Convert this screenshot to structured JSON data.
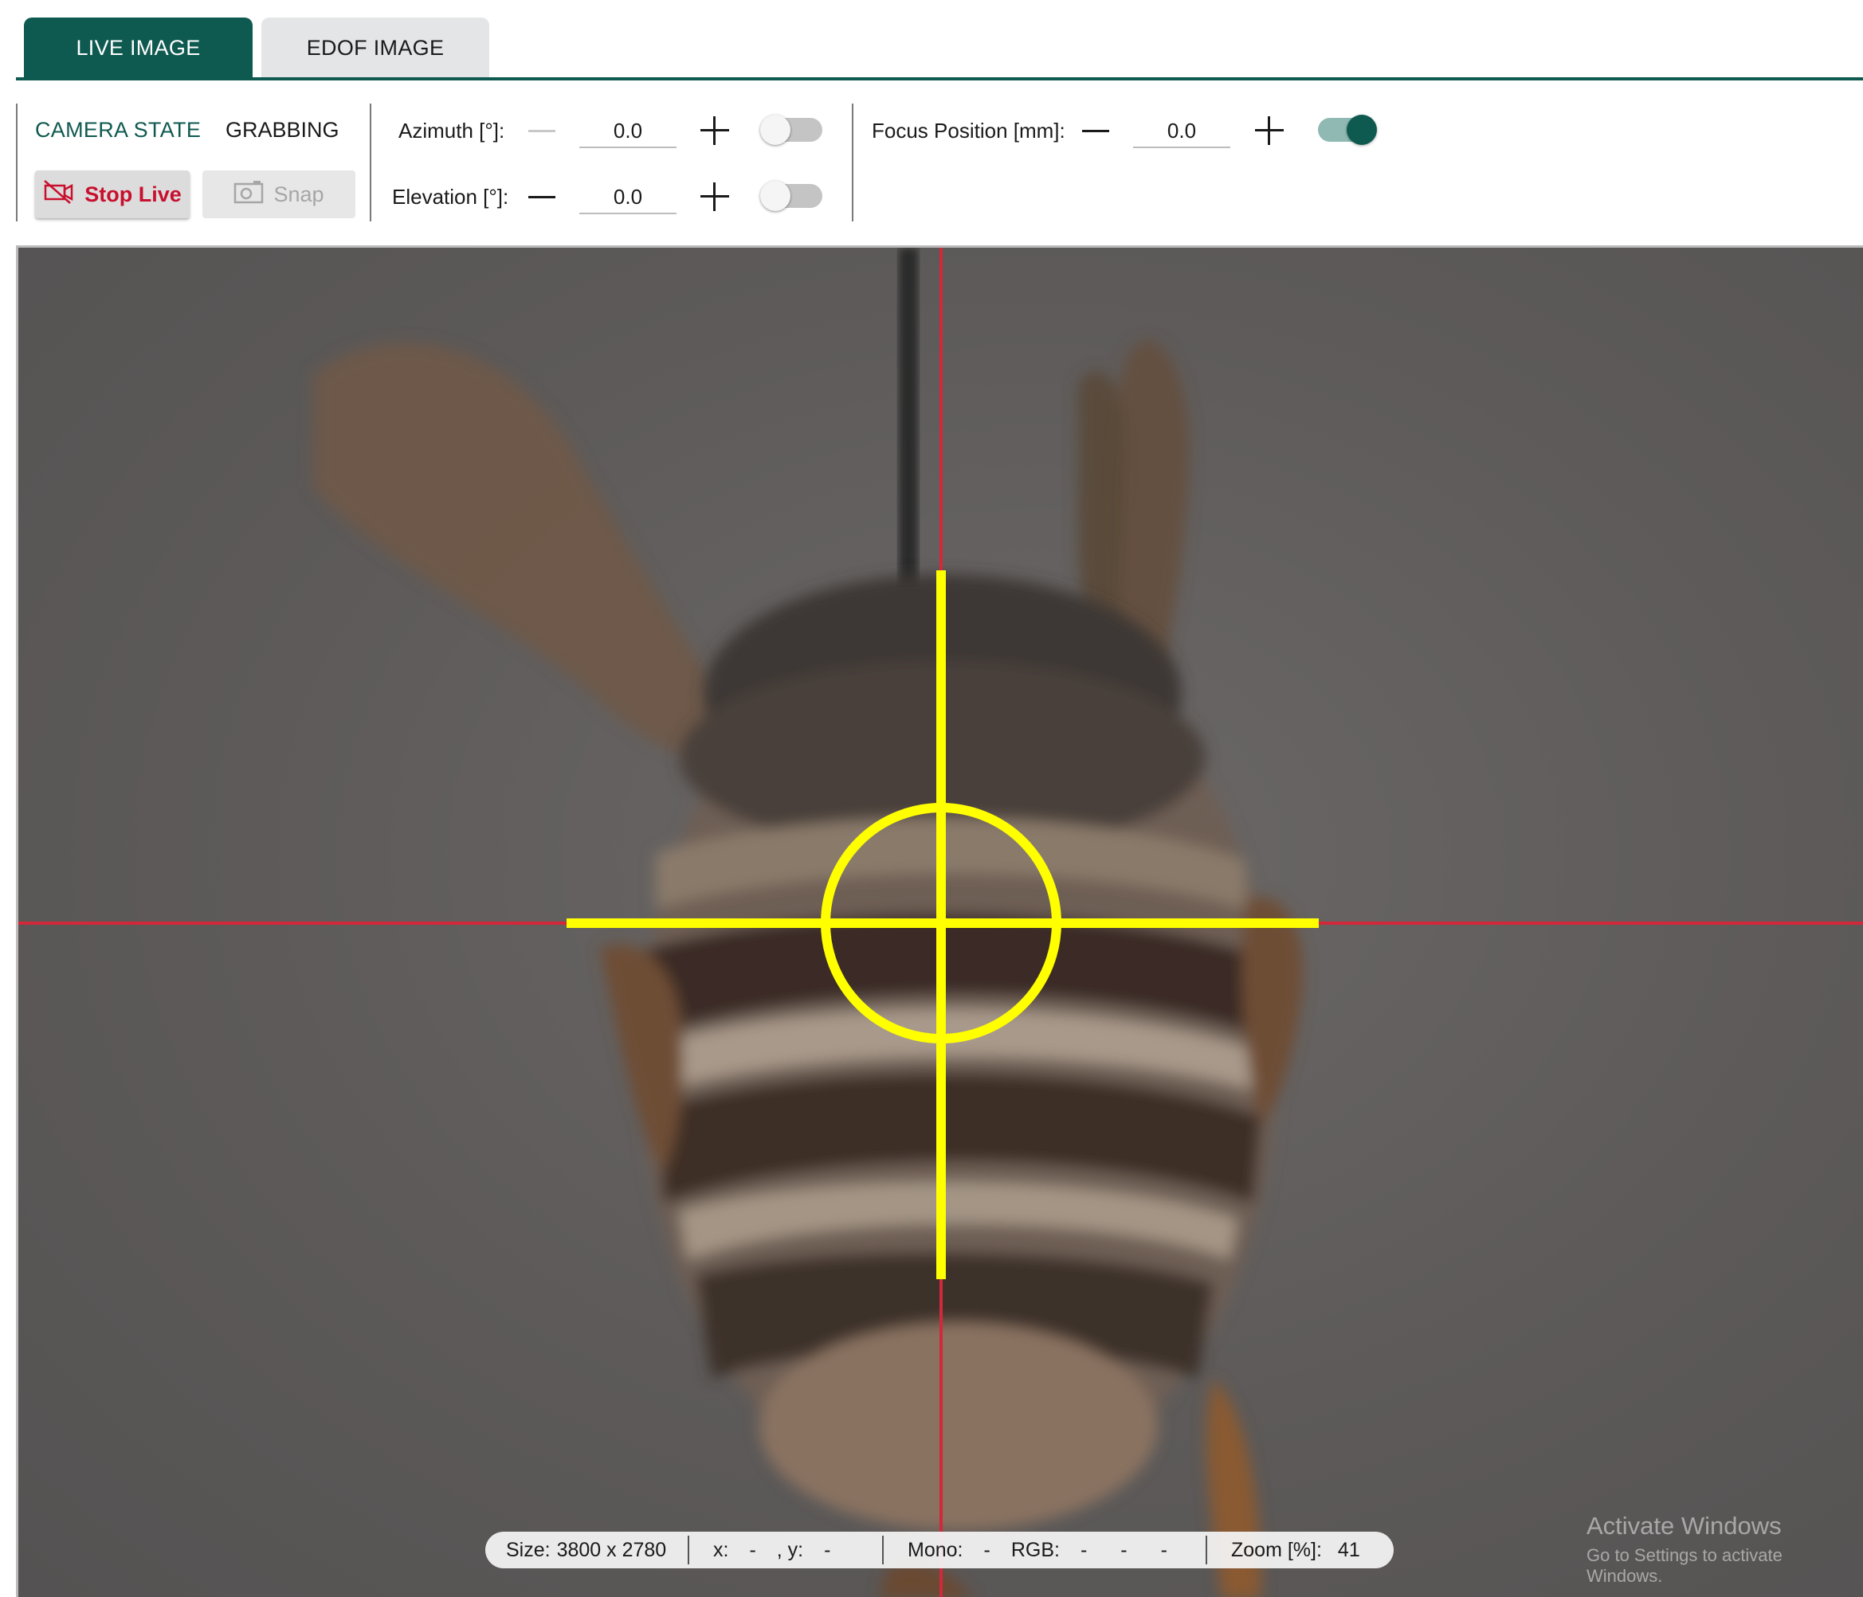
{
  "tabs": [
    {
      "label": "LIVE IMAGE",
      "active": true
    },
    {
      "label": "EDOF IMAGE",
      "active": false
    }
  ],
  "camera": {
    "state_label": "CAMERA STATE",
    "state_value": "GRABBING",
    "stop_live_label": "Stop Live",
    "snap_label": "Snap"
  },
  "orientation": {
    "azimuth_label": "Azimuth [°]:",
    "azimuth_value": "0.0",
    "azimuth_toggle": false,
    "elevation_label": "Elevation [°]:",
    "elevation_value": "0.0",
    "elevation_toggle": false
  },
  "focus": {
    "label": "Focus Position [mm]:",
    "value": "0.0",
    "toggle": true
  },
  "status": {
    "size_label": "Size:",
    "size_value": "3800 x 2780",
    "x_label": "x:",
    "x_value": "-",
    "y_label": ", y:",
    "y_value": "-",
    "mono_label": "Mono:",
    "mono_value": "-",
    "rgb_label": "RGB:",
    "rgb_r": "-",
    "rgb_g": "-",
    "rgb_b": "-",
    "zoom_label": "Zoom [%]:",
    "zoom_value": "41"
  },
  "watermark": {
    "line1": "Activate Windows",
    "line2": "Go to Settings to activate Windows."
  },
  "colors": {
    "accent": "#0f5a50",
    "stop_red": "#c8102e",
    "crosshair_red": "#d2283a",
    "reticle_yellow": "#ffff00"
  }
}
